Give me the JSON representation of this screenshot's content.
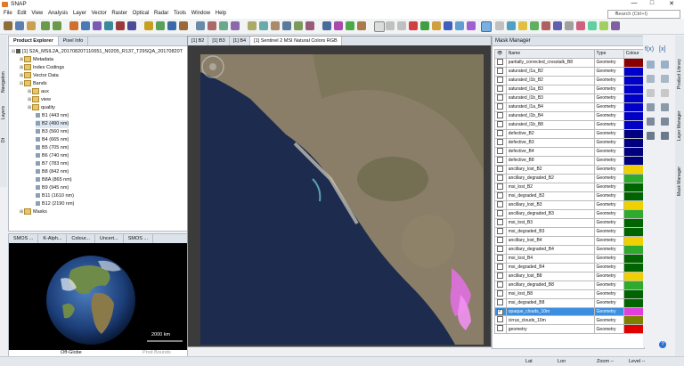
{
  "app": {
    "title": "SNAP",
    "controls": [
      "—",
      "□",
      "✕"
    ]
  },
  "menu": [
    "File",
    "Edit",
    "View",
    "Analysis",
    "Layer",
    "Vector",
    "Raster",
    "Optical",
    "Radar",
    "Tools",
    "Window",
    "Help"
  ],
  "search": {
    "placeholder": "Search (Ctrl+I)"
  },
  "left_panel": {
    "tabs": [
      "Product Explorer",
      "Pixel Info"
    ],
    "product": "[1] S2A_MSIL2A_20170820T110651_N0205_R137_T29SQA_20170820T",
    "nodes": [
      "Metadata",
      "Index Codings",
      "Vector Data",
      "Bands",
      "aux",
      "view",
      "quality"
    ],
    "bands": [
      "B1 (443 nm)",
      "B2 (490 nm)",
      "B3 (560 nm)",
      "B4 (665 nm)",
      "B5 (705 nm)",
      "B6 (740 nm)",
      "B7 (783 nm)",
      "B8 (842 nm)",
      "B8A (865 nm)",
      "B9 (945 nm)",
      "B11 (1610 nm)",
      "B12 (2190 nm)"
    ],
    "masks": "Masks"
  },
  "bottom_left": {
    "tabs": [
      "SMOS ...",
      "K-Alph...",
      "Colour...",
      "Uncert...",
      "SMOS ..."
    ],
    "scale": "2000 km",
    "footer": "Off-Globe",
    "footer2": "Prod Bounds"
  },
  "side_left": [
    "Navigation",
    "Layers",
    "Dt"
  ],
  "center": {
    "tabs": [
      "[1] B2",
      "[1] B3",
      "[1] B4",
      "[1] Sentinel 2 MSI Natural Colors RGB"
    ]
  },
  "mask_manager": {
    "title": "Mask Manager",
    "headers": [
      "Name",
      "Type",
      "Colour"
    ],
    "rows": [
      {
        "name": "partially_corrected_crosstalk_B8",
        "type": "Geometry",
        "color": "#8b0000",
        "checked": false
      },
      {
        "name": "saturated_l1a_B2",
        "type": "Geometry",
        "color": "#0000c8",
        "checked": false
      },
      {
        "name": "saturated_l1b_B2",
        "type": "Geometry",
        "color": "#0000c8",
        "checked": false
      },
      {
        "name": "saturated_l1a_B3",
        "type": "Geometry",
        "color": "#0000c8",
        "checked": false
      },
      {
        "name": "saturated_l1b_B3",
        "type": "Geometry",
        "color": "#0000c8",
        "checked": false
      },
      {
        "name": "saturated_l1a_B4",
        "type": "Geometry",
        "color": "#0000c8",
        "checked": false
      },
      {
        "name": "saturated_l1b_B4",
        "type": "Geometry",
        "color": "#0000c8",
        "checked": false
      },
      {
        "name": "saturated_l1b_B8",
        "type": "Geometry",
        "color": "#0000c8",
        "checked": false
      },
      {
        "name": "defective_B2",
        "type": "Geometry",
        "color": "#000080",
        "checked": false
      },
      {
        "name": "defective_B3",
        "type": "Geometry",
        "color": "#000080",
        "checked": false
      },
      {
        "name": "defective_B4",
        "type": "Geometry",
        "color": "#000080",
        "checked": false
      },
      {
        "name": "defective_B8",
        "type": "Geometry",
        "color": "#000080",
        "checked": false
      },
      {
        "name": "ancillary_lost_B2",
        "type": "Geometry",
        "color": "#f0d000",
        "checked": false
      },
      {
        "name": "ancillary_degraded_B2",
        "type": "Geometry",
        "color": "#2eaa2e",
        "checked": false
      },
      {
        "name": "msi_lost_B2",
        "type": "Geometry",
        "color": "#006400",
        "checked": false
      },
      {
        "name": "msi_degraded_B2",
        "type": "Geometry",
        "color": "#006400",
        "checked": false
      },
      {
        "name": "ancillary_lost_B3",
        "type": "Geometry",
        "color": "#f0d000",
        "checked": false
      },
      {
        "name": "ancillary_degraded_B3",
        "type": "Geometry",
        "color": "#2eaa2e",
        "checked": false
      },
      {
        "name": "msi_lost_B3",
        "type": "Geometry",
        "color": "#006400",
        "checked": false
      },
      {
        "name": "msi_degraded_B3",
        "type": "Geometry",
        "color": "#006400",
        "checked": false
      },
      {
        "name": "ancillary_lost_B4",
        "type": "Geometry",
        "color": "#f0d000",
        "checked": false
      },
      {
        "name": "ancillary_degraded_B4",
        "type": "Geometry",
        "color": "#2eaa2e",
        "checked": false
      },
      {
        "name": "msi_lost_B4",
        "type": "Geometry",
        "color": "#006400",
        "checked": false
      },
      {
        "name": "msi_degraded_B4",
        "type": "Geometry",
        "color": "#006400",
        "checked": false
      },
      {
        "name": "ancillary_lost_B8",
        "type": "Geometry",
        "color": "#f0d000",
        "checked": false
      },
      {
        "name": "ancillary_degraded_B8",
        "type": "Geometry",
        "color": "#2eaa2e",
        "checked": false
      },
      {
        "name": "msi_lost_B8",
        "type": "Geometry",
        "color": "#006400",
        "checked": false
      },
      {
        "name": "msi_degraded_B8",
        "type": "Geometry",
        "color": "#006400",
        "checked": false
      },
      {
        "name": "opaque_clouds_10m",
        "type": "Geometry",
        "color": "#e040e0",
        "checked": true,
        "selected": true
      },
      {
        "name": "cirrus_clouds_10m",
        "type": "Geometry",
        "color": "#808000",
        "checked": false
      },
      {
        "name": "geometry",
        "type": "Geometry",
        "color": "#e00000",
        "checked": false
      }
    ]
  },
  "right_strip": [
    "Product Library",
    "Layer Manager",
    "Mask Manager"
  ],
  "status": {
    "lat": "Lat",
    "lon": "Lon",
    "zoom": "Zoom --",
    "level": "Level --"
  }
}
